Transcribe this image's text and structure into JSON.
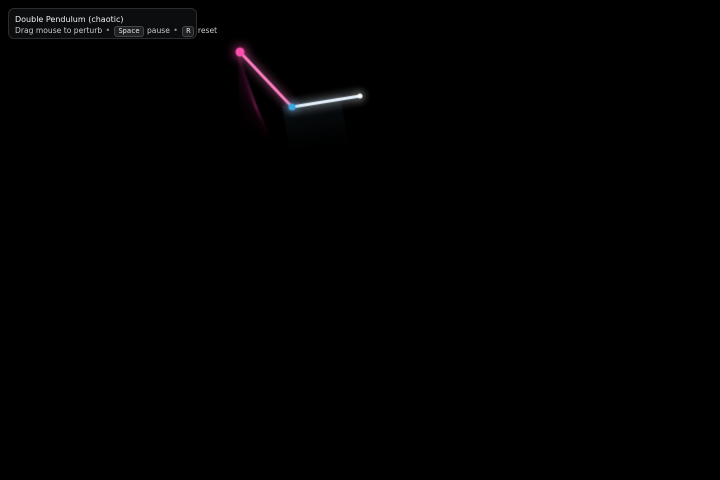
{
  "hud": {
    "title": "Double Pendulum (chaotic)",
    "drag_hint": "Drag mouse to perturb",
    "separator": "•",
    "pause_key": "Space",
    "pause_label": "pause",
    "reset_key": "R",
    "reset_label": "reset"
  },
  "colors": {
    "background": "#000000",
    "pivot_bob": "#ff4fb0",
    "upper_rod": "#ff7fc4",
    "middle_bob": "#3aa9e0",
    "lower_rod": "#e8f4ff",
    "end_bob": "#ffffff"
  },
  "icons": {
    "pivot": "pivot-bob-icon",
    "middle": "middle-bob-icon",
    "end": "end-bob-icon"
  }
}
